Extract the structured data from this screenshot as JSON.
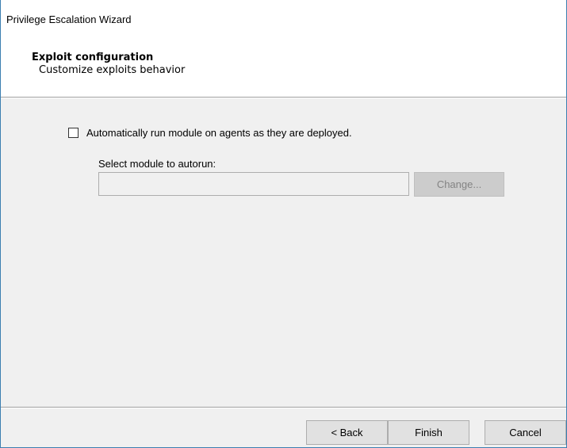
{
  "window": {
    "title": "Privilege Escalation Wizard"
  },
  "header": {
    "title": "Exploit configuration",
    "subtitle": "Customize exploits behavior"
  },
  "options": {
    "autorun_checkbox": {
      "label": "Automatically run module on agents as they are deployed.",
      "checked": false
    },
    "module_label": "Select module to autorun:",
    "module_value": "",
    "change_button_label": "Change...",
    "change_button_enabled": false
  },
  "footer": {
    "back_label": "< Back",
    "finish_label": "Finish",
    "cancel_label": "Cancel"
  },
  "colors": {
    "window_border": "#3c7fb1",
    "dialog_background": "#f0f0f0",
    "header_background": "#ffffff",
    "button_face": "#e1e1e1",
    "disabled_button_face": "#cccccc",
    "disabled_text": "#838383"
  }
}
